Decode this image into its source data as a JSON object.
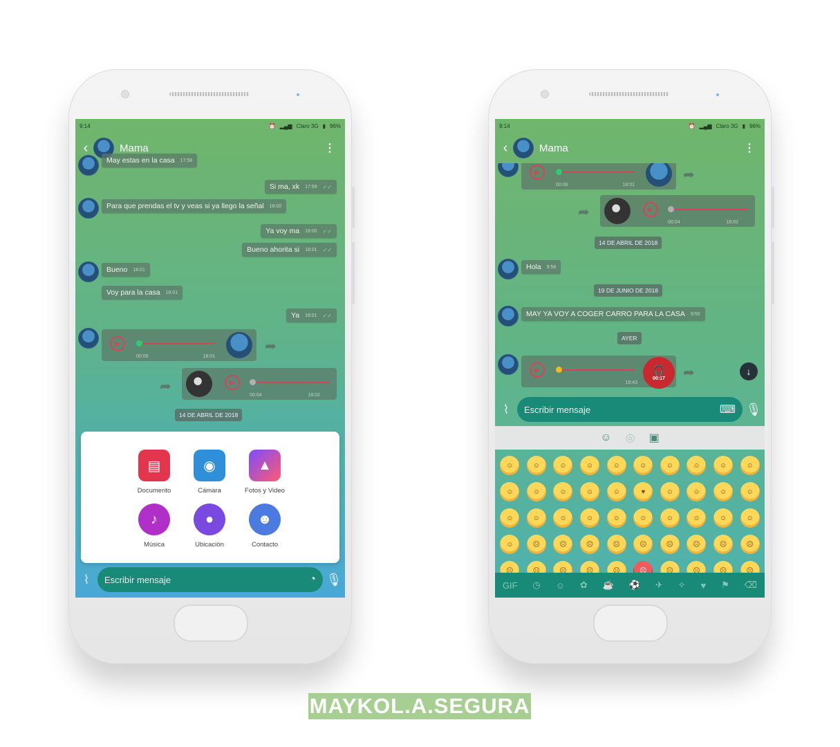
{
  "colors": {
    "accent": "#1a8a78",
    "bubble": "#5c7868",
    "voice_red": "#d8435a",
    "record_red": "#c9282f",
    "watermark": "#a7cf92"
  },
  "left": {
    "status": {
      "time": "9:14",
      "carrier": "Claro 3G",
      "battery": "96%"
    },
    "header": {
      "name": "Mama",
      "back_icon": "chevron-left-icon",
      "menu_icon": "more-vertical-icon"
    },
    "messages": [
      {
        "text": "May estas en la casa",
        "time": "17:58"
      },
      {
        "text": "Si ma, xk",
        "time": "17:59"
      },
      {
        "text": "Para que prendas el tv y veas si ya llego la señal",
        "time": "18:00"
      },
      {
        "text": "Ya voy ma",
        "time": "18:00"
      },
      {
        "text": "Bueno ahorita si",
        "time": "18:01"
      },
      {
        "text": "Bueno",
        "time": "18:01"
      },
      {
        "text": "Voy para la casa",
        "time": "18:01"
      },
      {
        "text": "Ya",
        "time": "18:01"
      }
    ],
    "voice1": {
      "duration": "00:06",
      "time": "18:01"
    },
    "voice2": {
      "duration": "00:04",
      "time": "18:02"
    },
    "date": "14 DE ABRIL DE 2018",
    "attach": {
      "items": [
        {
          "label": "Documento",
          "icon": "document-icon"
        },
        {
          "label": "Cámara",
          "icon": "camera-icon"
        },
        {
          "label": "Fotos y Video",
          "icon": "gallery-icon"
        },
        {
          "label": "Música",
          "icon": "music-icon"
        },
        {
          "label": "Ubicación",
          "icon": "location-icon"
        },
        {
          "label": "Contacto",
          "icon": "contact-icon"
        }
      ]
    },
    "input": {
      "placeholder": "Escribir mensaje"
    }
  },
  "right": {
    "status": {
      "time": "9:14",
      "carrier": "Claro 3G",
      "battery": "96%"
    },
    "header": {
      "name": "Mama"
    },
    "voice_top": {
      "duration": "00:06",
      "time": "18:01"
    },
    "voice_mid": {
      "duration": "00:04",
      "time": "18:02"
    },
    "date1": "14 DE ABRIL DE 2018",
    "msg_hola": {
      "text": "Hola",
      "time": "9:58"
    },
    "date2": "19 DE JUNIO DE 2018",
    "msg_may": {
      "text": "MAY YA VOY A COGER CARRO PARA LA CASA",
      "time": "9:50"
    },
    "date3": "AYER",
    "voice_rec": {
      "time": "19:43",
      "recording": "00:17"
    },
    "input": {
      "placeholder": "Escribir mensaje"
    }
  },
  "watermark": "MAYKOL.A.SEGURA"
}
